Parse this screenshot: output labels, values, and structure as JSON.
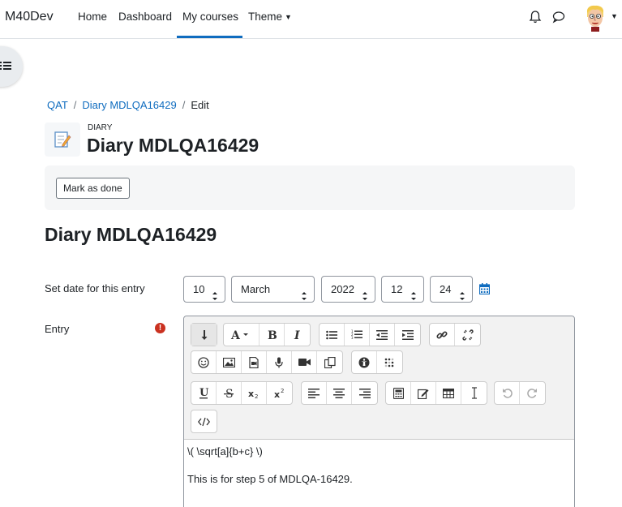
{
  "navbar": {
    "brand": "M40Dev",
    "items": [
      {
        "label": "Home"
      },
      {
        "label": "Dashboard"
      },
      {
        "label": "My courses"
      },
      {
        "label": "Theme"
      }
    ]
  },
  "breadcrumb": {
    "items": [
      "QAT",
      "Diary MDLQA16429",
      "Edit"
    ]
  },
  "header": {
    "pre_title": "DIARY",
    "title": "Diary MDLQA16429"
  },
  "completion": {
    "mark_done_label": "Mark as done"
  },
  "main_heading": "Diary MDLQA16429",
  "form": {
    "date_label": "Set date for this entry",
    "date": {
      "day": "10",
      "month": "March",
      "year": "2022",
      "hour": "12",
      "minute": "24"
    },
    "entry_label": "Entry",
    "editor_content": {
      "line1": "\\( \\sqrt[a]{b+c} \\)",
      "line2": "This is for step 5 of MDLQA-16429."
    }
  },
  "colors": {
    "link": "#0f6cbf",
    "required": "#ca3120",
    "toolbar_bg": "#f2f2f2"
  }
}
